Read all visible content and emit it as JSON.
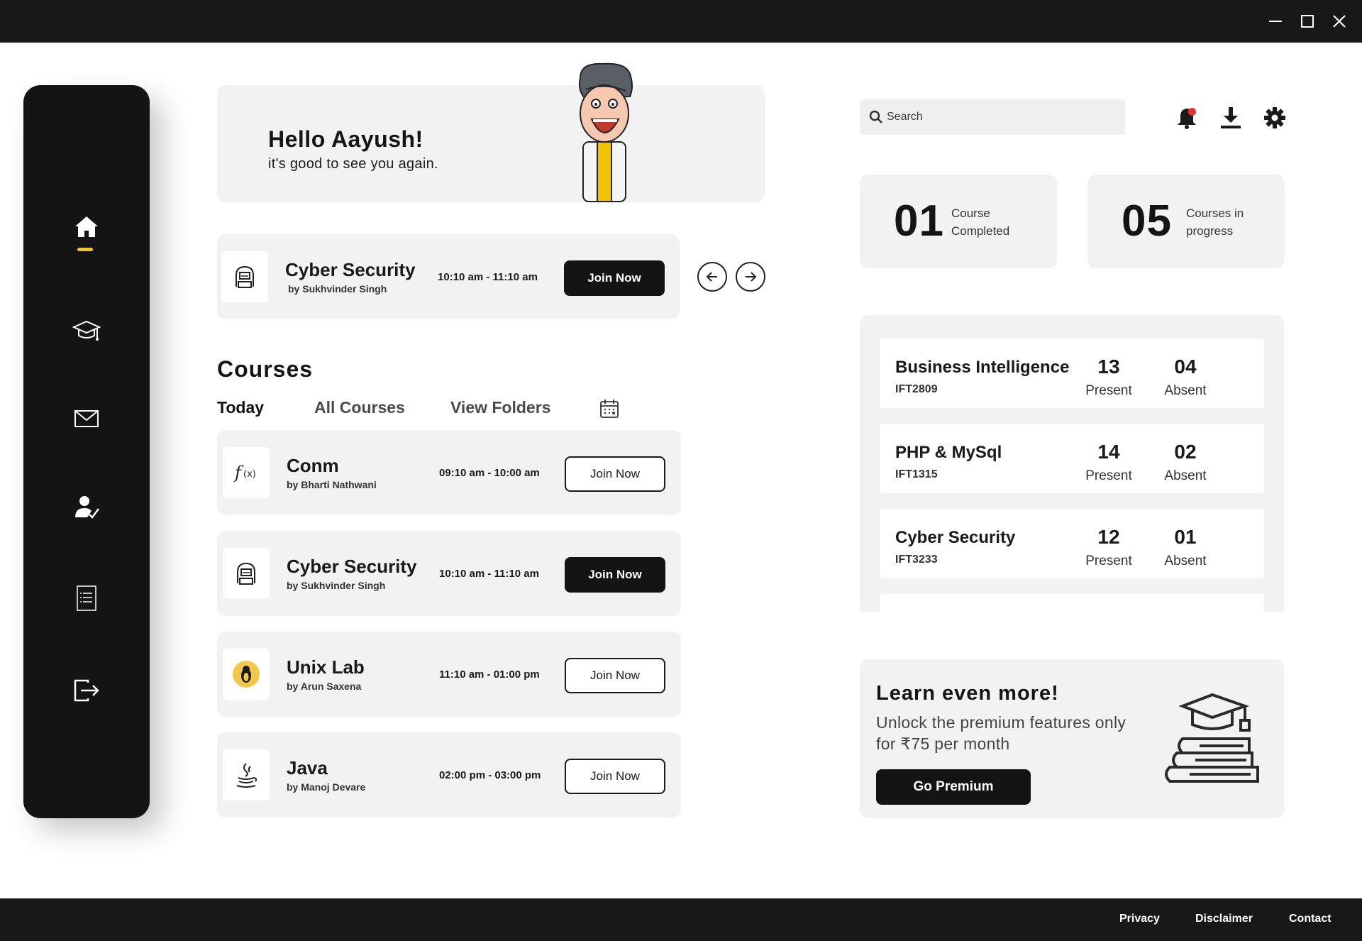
{
  "window": {
    "controls": {
      "minimize": "minimize-icon",
      "maximize": "maximize-icon",
      "close": "close-icon"
    }
  },
  "sidebar": {
    "items": [
      {
        "name": "home",
        "icon": "home-icon",
        "active": true
      },
      {
        "name": "courses",
        "icon": "graduation-cap-icon",
        "active": false
      },
      {
        "name": "messages",
        "icon": "mail-icon",
        "active": false
      },
      {
        "name": "attendance",
        "icon": "user-check-icon",
        "active": false
      },
      {
        "name": "notes",
        "icon": "document-list-icon",
        "active": false
      },
      {
        "name": "logout",
        "icon": "logout-icon",
        "active": false
      }
    ],
    "accent": "#f5c518"
  },
  "greeting": {
    "title": "Hello Aayush!",
    "subtitle": "it's good to see you again."
  },
  "featured": {
    "name": "Cyber Security",
    "by": "by Sukhvinder Singh",
    "time": "10:10 am - 11:10 am",
    "button": "Join Now",
    "icon": "hacker-icon"
  },
  "courses": {
    "title": "Courses",
    "tabs": [
      "Today",
      "All Courses",
      "View Folders"
    ],
    "active_tab": "Today",
    "items": [
      {
        "name": "Conm",
        "by": "by Bharti Nathwani",
        "time": "09:10 am - 10:00 am",
        "button": "Join Now",
        "icon": "function-icon",
        "primary": false
      },
      {
        "name": "Cyber Security",
        "by": "by Sukhvinder Singh",
        "time": "10:10 am - 11:10 am",
        "button": "Join Now",
        "icon": "hacker-icon",
        "primary": true
      },
      {
        "name": "Unix Lab",
        "by": "by Arun Saxena",
        "time": "11:10 am - 01:00 pm",
        "button": "Join Now",
        "icon": "linux-penguin-icon",
        "primary": false
      },
      {
        "name": "Java",
        "by": "by Manoj Devare",
        "time": "02:00 pm - 03:00 pm",
        "button": "Join Now",
        "icon": "java-coffee-icon",
        "primary": false
      }
    ]
  },
  "search": {
    "placeholder": "Search"
  },
  "stats": [
    {
      "value": "01",
      "label": "Course Completed"
    },
    {
      "value": "05",
      "label": "Courses in progress"
    }
  ],
  "attendance": [
    {
      "name": "Business Intelligence",
      "code": "IFT2809",
      "present": "13",
      "absent": "04"
    },
    {
      "name": "PHP & MySql",
      "code": "IFT1315",
      "present": "14",
      "absent": "02"
    },
    {
      "name": "Cyber Security",
      "code": "IFT3233",
      "present": "12",
      "absent": "01"
    }
  ],
  "attendance_labels": {
    "present": "Present",
    "absent": "Absent"
  },
  "promo": {
    "title": "Learn even more!",
    "subtitle": "Unlock the premium features only for ₹75 per month",
    "button": "Go Premium"
  },
  "footer": {
    "links": [
      "Privacy",
      "Disclaimer",
      "Contact"
    ]
  },
  "colors": {
    "dark": "#141414",
    "panel": "#f2f2f2",
    "notification": "#e53030"
  }
}
